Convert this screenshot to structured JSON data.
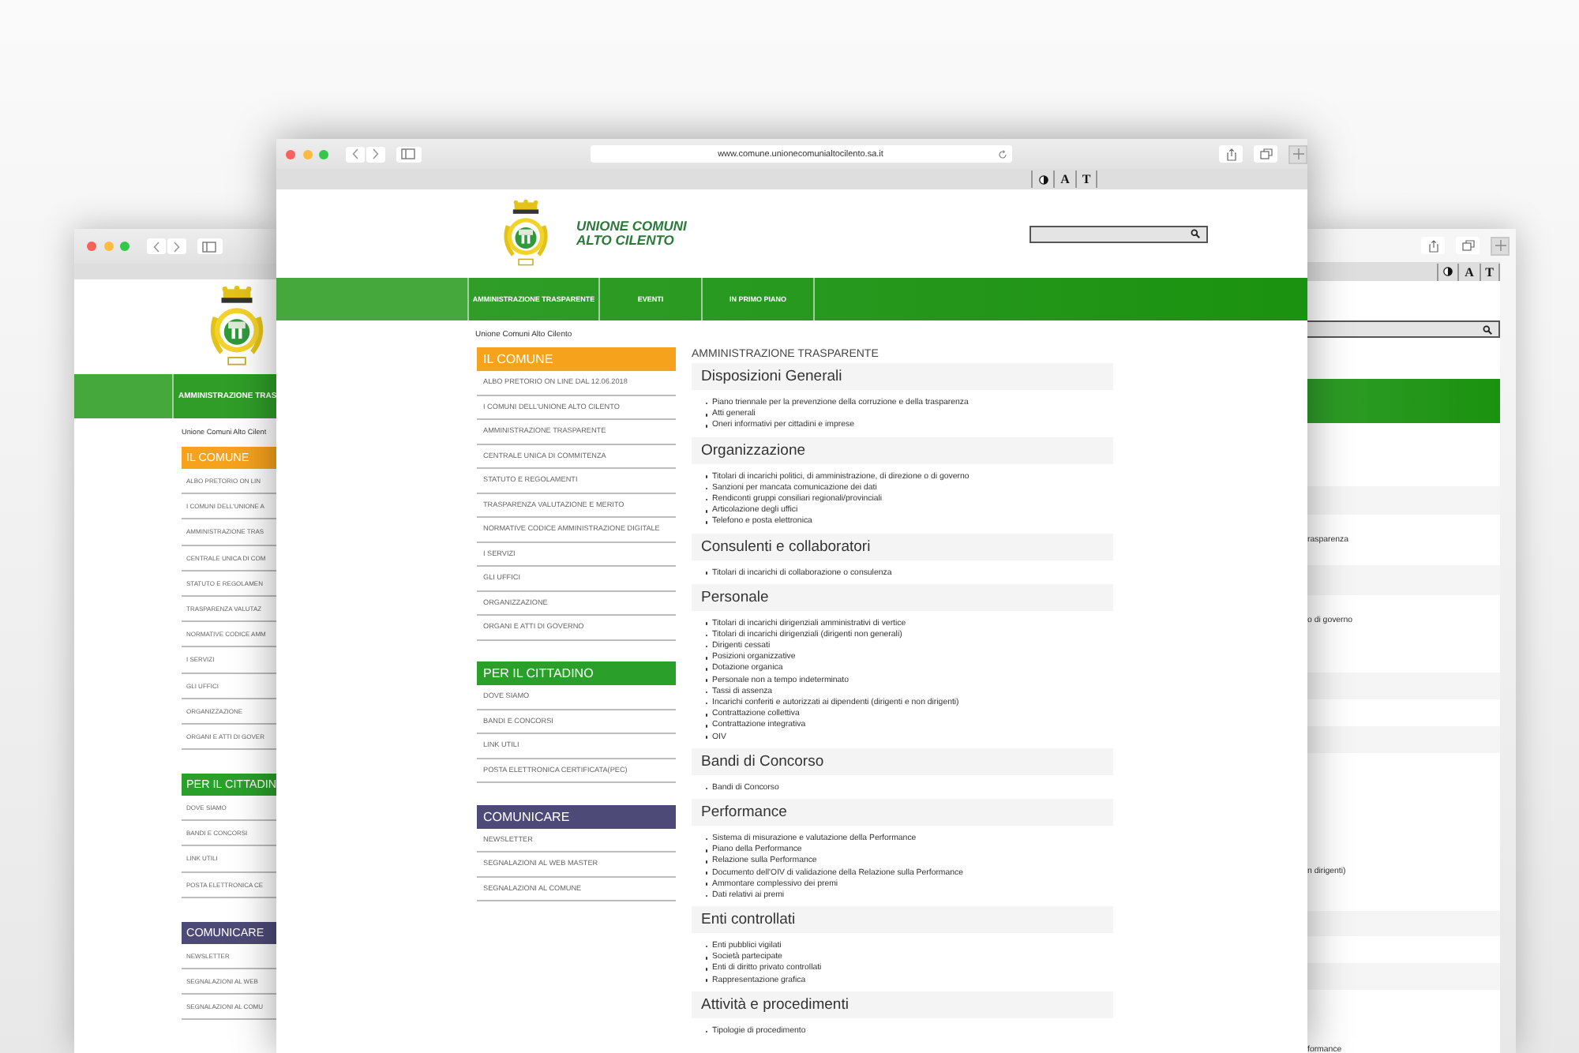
{
  "back_window_left": {
    "nav": [
      "AMMINISTRAZIONE TRAS"
    ],
    "breadcrumb": "Unione Comuni Alto Cilent",
    "sidebar": [
      {
        "title": "IL COMUNE",
        "color": "#f6a21d",
        "items": [
          "ALBO PRETORIO ON LIN",
          "I COMUNI DELL'UNIONE A",
          "AMMINISTRAZIONE TRAS",
          "CENTRALE UNICA DI COM",
          "STATUTO E REGOLAMEN",
          "TRASPARENZA VALUTAZ",
          "NORMATIVE CODICE AMM",
          "I SERVIZI",
          "GLI UFFICI",
          "ORGANIZZAZIONE",
          "ORGANI E ATTI DI GOVER"
        ]
      },
      {
        "title": "PER IL CITTADIN",
        "color": "#2a9f2a",
        "items": [
          "DOVE SIAMO",
          "BANDI E CONCORSI",
          "LINK UTILI",
          "POSTA ELETTRONICA CE"
        ]
      },
      {
        "title": "COMUNICARE",
        "color": "#4e4a78",
        "items": [
          "NEWSLETTER",
          "SEGNALAZIONI AL WEB",
          "SEGNALAZIONI AL COMU"
        ]
      }
    ]
  },
  "back_window_right": {
    "text_tools": [
      "A",
      "T"
    ],
    "fragments": [
      "rasparenza",
      "o di governo",
      "n dirigenti)",
      "formance"
    ]
  },
  "front_window": {
    "url": "www.comune.unionecomunialtocilento.sa.it",
    "text_tools": [
      "A",
      "T"
    ],
    "site_title": [
      "UNIONE COMUNI",
      "ALTO CILENTO"
    ],
    "nav": [
      "AMMINISTRAZIONE TRASPARENTE",
      "EVENTI",
      "IN PRIMO PIANO"
    ],
    "breadcrumb": "Unione Comuni Alto Cilento",
    "sidebar": [
      {
        "title": "IL COMUNE",
        "color": "#f6a21d",
        "items": [
          "ALBO PRETORIO ON LINE DAL 12.06.2018",
          "I COMUNI DELL'UNIONE ALTO CILENTO",
          "AMMINISTRAZIONE TRASPARENTE",
          "CENTRALE UNICA DI COMMITENZA",
          "STATUTO E REGOLAMENTI",
          "TRASPARENZA VALUTAZIONE E MERITO",
          "NORMATIVE CODICE AMMINISTRAZIONE DIGITALE",
          "I SERVIZI",
          "GLI UFFICI",
          "ORGANIZZAZIONE",
          "ORGANI E ATTI DI GOVERNO"
        ]
      },
      {
        "title": "PER IL CITTADINO",
        "color": "#2a9f2a",
        "items": [
          "DOVE SIAMO",
          "BANDI E CONCORSI",
          "LINK UTILI",
          "POSTA ELETTRONICA CERTIFICATA(PEC)"
        ]
      },
      {
        "title": "COMUNICARE",
        "color": "#4e4a78",
        "items": [
          "NEWSLETTER",
          "SEGNALAZIONI AL WEB MASTER",
          "SEGNALAZIONI AL COMUNE"
        ]
      }
    ],
    "page_title": "AMMINISTRAZIONE TRASPARENTE",
    "sections": [
      {
        "heading": "Disposizioni Generali",
        "items": [
          "Piano triennale per la prevenzione della corruzione e della trasparenza",
          "Atti generali",
          "Oneri informativi per cittadini e imprese"
        ]
      },
      {
        "heading": "Organizzazione",
        "items": [
          "Titolari di incarichi politici, di amministrazione, di direzione o di governo",
          "Sanzioni per mancata comunicazione dei dati",
          "Rendiconti gruppi consiliari regionali/provinciali",
          "Articolazione degli uffici",
          "Telefono e posta elettronica"
        ]
      },
      {
        "heading": "Consulenti e collaboratori",
        "items": [
          "Titolari di incarichi di collaborazione o consulenza"
        ]
      },
      {
        "heading": "Personale",
        "items": [
          "Titolari di incarichi dirigenziali amministrativi di vertice",
          "Titolari di incarichi dirigenziali (dirigenti non generali)",
          "Dirigenti cessati",
          "Posizioni organizzative",
          "Dotazione organica",
          "Personale non a tempo indeterminato",
          "Tassi di assenza",
          "Incarichi conferiti e autorizzati ai dipendenti (dirigenti e non dirigenti)",
          "Contrattazione collettiva",
          "Contrattazione integrativa",
          "OIV"
        ]
      },
      {
        "heading": "Bandi di Concorso",
        "items": [
          "Bandi di Concorso"
        ]
      },
      {
        "heading": "Performance",
        "items": [
          "Sistema di misurazione e valutazione della Performance",
          "Piano della Performance",
          "Relazione sulla Performance",
          "Documento dell'OIV di validazione della Relazione sulla Performance",
          "Ammontare complessivo dei premi",
          "Dati relativi ai premi"
        ]
      },
      {
        "heading": "Enti controllati",
        "items": [
          "Enti pubblici vigilati",
          "Società partecipate",
          "Enti di diritto privato controllati",
          "Rappresentazione grafica"
        ]
      },
      {
        "heading": "Attività e procedimenti",
        "items": [
          "Tipologie di procedimento"
        ]
      }
    ]
  }
}
